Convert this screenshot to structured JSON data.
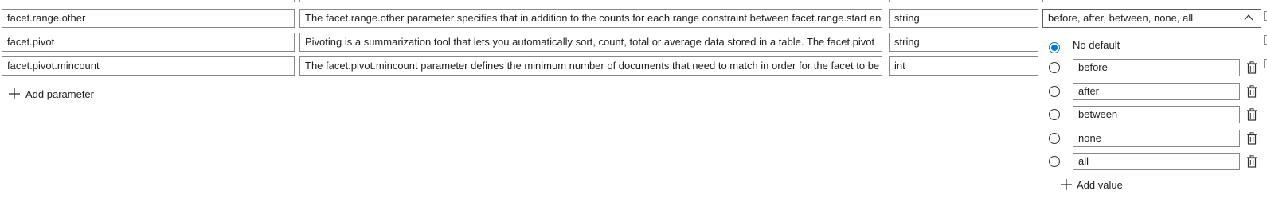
{
  "parameters": [
    {
      "name": "facet.range.other",
      "description": "The facet.range.other parameter specifies that in addition to the counts for each range constraint between facet.range.start and facet.range.end",
      "type": "string",
      "default_display": "before, after, between, none, all"
    },
    {
      "name": "facet.pivot",
      "description": "Pivoting is a summarization tool that lets you automatically sort, count, total or average data stored in a table. The facet.pivot",
      "type": "string"
    },
    {
      "name": "facet.pivot.mincount",
      "description": "The facet.pivot.mincount parameter defines the minimum number of documents that need to match in order for the facet to be",
      "type": "int"
    }
  ],
  "add_parameter_label": "Add parameter",
  "values_panel": {
    "no_default_label": "No default",
    "selected": "No default",
    "values": [
      "before",
      "after",
      "between",
      "none",
      "all"
    ],
    "add_value_label": "Add value"
  },
  "colors": {
    "accent": "#0078d4",
    "border": "#8a8886",
    "text": "#1f1f1f"
  },
  "icons": {
    "add": "plus-icon",
    "delete": "trash-icon",
    "dropdown": "chevron-up-icon"
  }
}
